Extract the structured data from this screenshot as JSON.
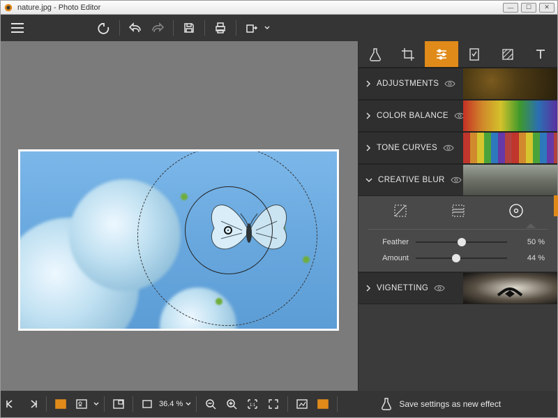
{
  "title": "nature.jpg - Photo Editor",
  "win": {
    "min": "—",
    "max": "☐",
    "close": "✕"
  },
  "tabs": [
    {
      "name": "lab-tab",
      "icon": "flask"
    },
    {
      "name": "crop-tab",
      "icon": "crop"
    },
    {
      "name": "sliders-tab",
      "icon": "sliders",
      "active": true
    },
    {
      "name": "preset-tab",
      "icon": "page"
    },
    {
      "name": "overlay-tab",
      "icon": "hatch"
    },
    {
      "name": "text-tab",
      "icon": "text"
    }
  ],
  "panels": {
    "adjustments": {
      "label": "ADJUSTMENTS",
      "expanded": false
    },
    "color_balance": {
      "label": "COLOR BALANCE",
      "expanded": false
    },
    "tone_curves": {
      "label": "TONE CURVES",
      "expanded": false
    },
    "creative_blur": {
      "label": "CREATIVE BLUR",
      "expanded": true,
      "modes": [
        {
          "name": "no-blur",
          "active": false
        },
        {
          "name": "linear-blur",
          "active": false
        },
        {
          "name": "radial-blur",
          "active": true
        }
      ],
      "sliders": {
        "feather": {
          "label": "Feather",
          "value": 50,
          "display": "50 %"
        },
        "amount": {
          "label": "Amount",
          "value": 44,
          "display": "44 %"
        }
      }
    },
    "vignetting": {
      "label": "VIGNETTING",
      "expanded": false
    }
  },
  "zoom": {
    "level": "36.4 %"
  },
  "bottom": {
    "save_effect": "Save settings as new effect"
  }
}
